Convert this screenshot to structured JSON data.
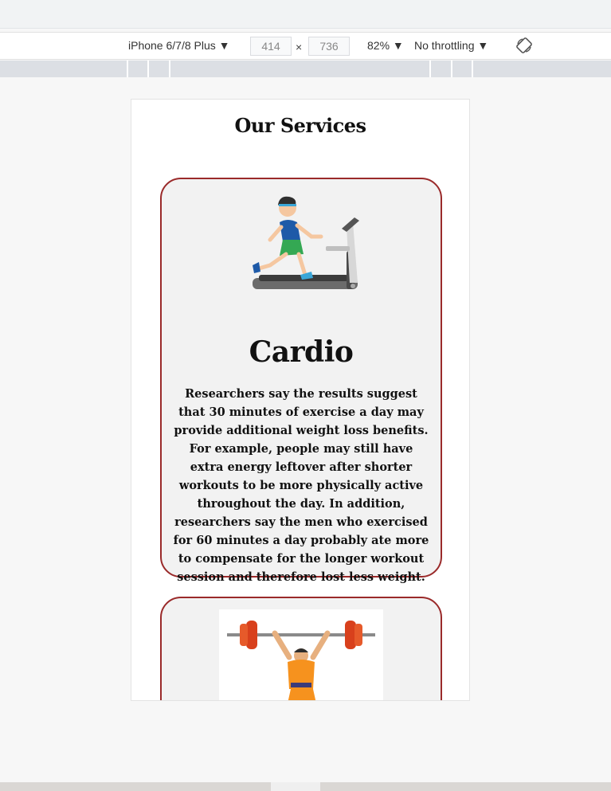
{
  "devtools": {
    "device_label": "iPhone 6/7/8 Plus ▼",
    "width_value": "414",
    "height_value": "736",
    "times_symbol": "×",
    "zoom_label": "82% ▼",
    "throttle_label": "No throttling ▼",
    "rotate_icon": "rotate-icon"
  },
  "page": {
    "section_title": "Our Services",
    "cards": [
      {
        "title": "Cardio",
        "text": "Researchers say the results suggest that 30 minutes of exercise a day may provide additional weight loss benefits. For example, people may still have extra energy leftover after shorter workouts to be more physically active throughout the day. In addition, researchers say the men who exercised for 60 minutes a day probably ate more to compensate for the longer workout session and therefore lost less weight.",
        "image": "treadmill-runner-illustration"
      },
      {
        "image": "weightlifter-illustration"
      }
    ]
  },
  "colors": {
    "card_border": "#9a2a2a",
    "card_bg": "#f2f2f2"
  }
}
